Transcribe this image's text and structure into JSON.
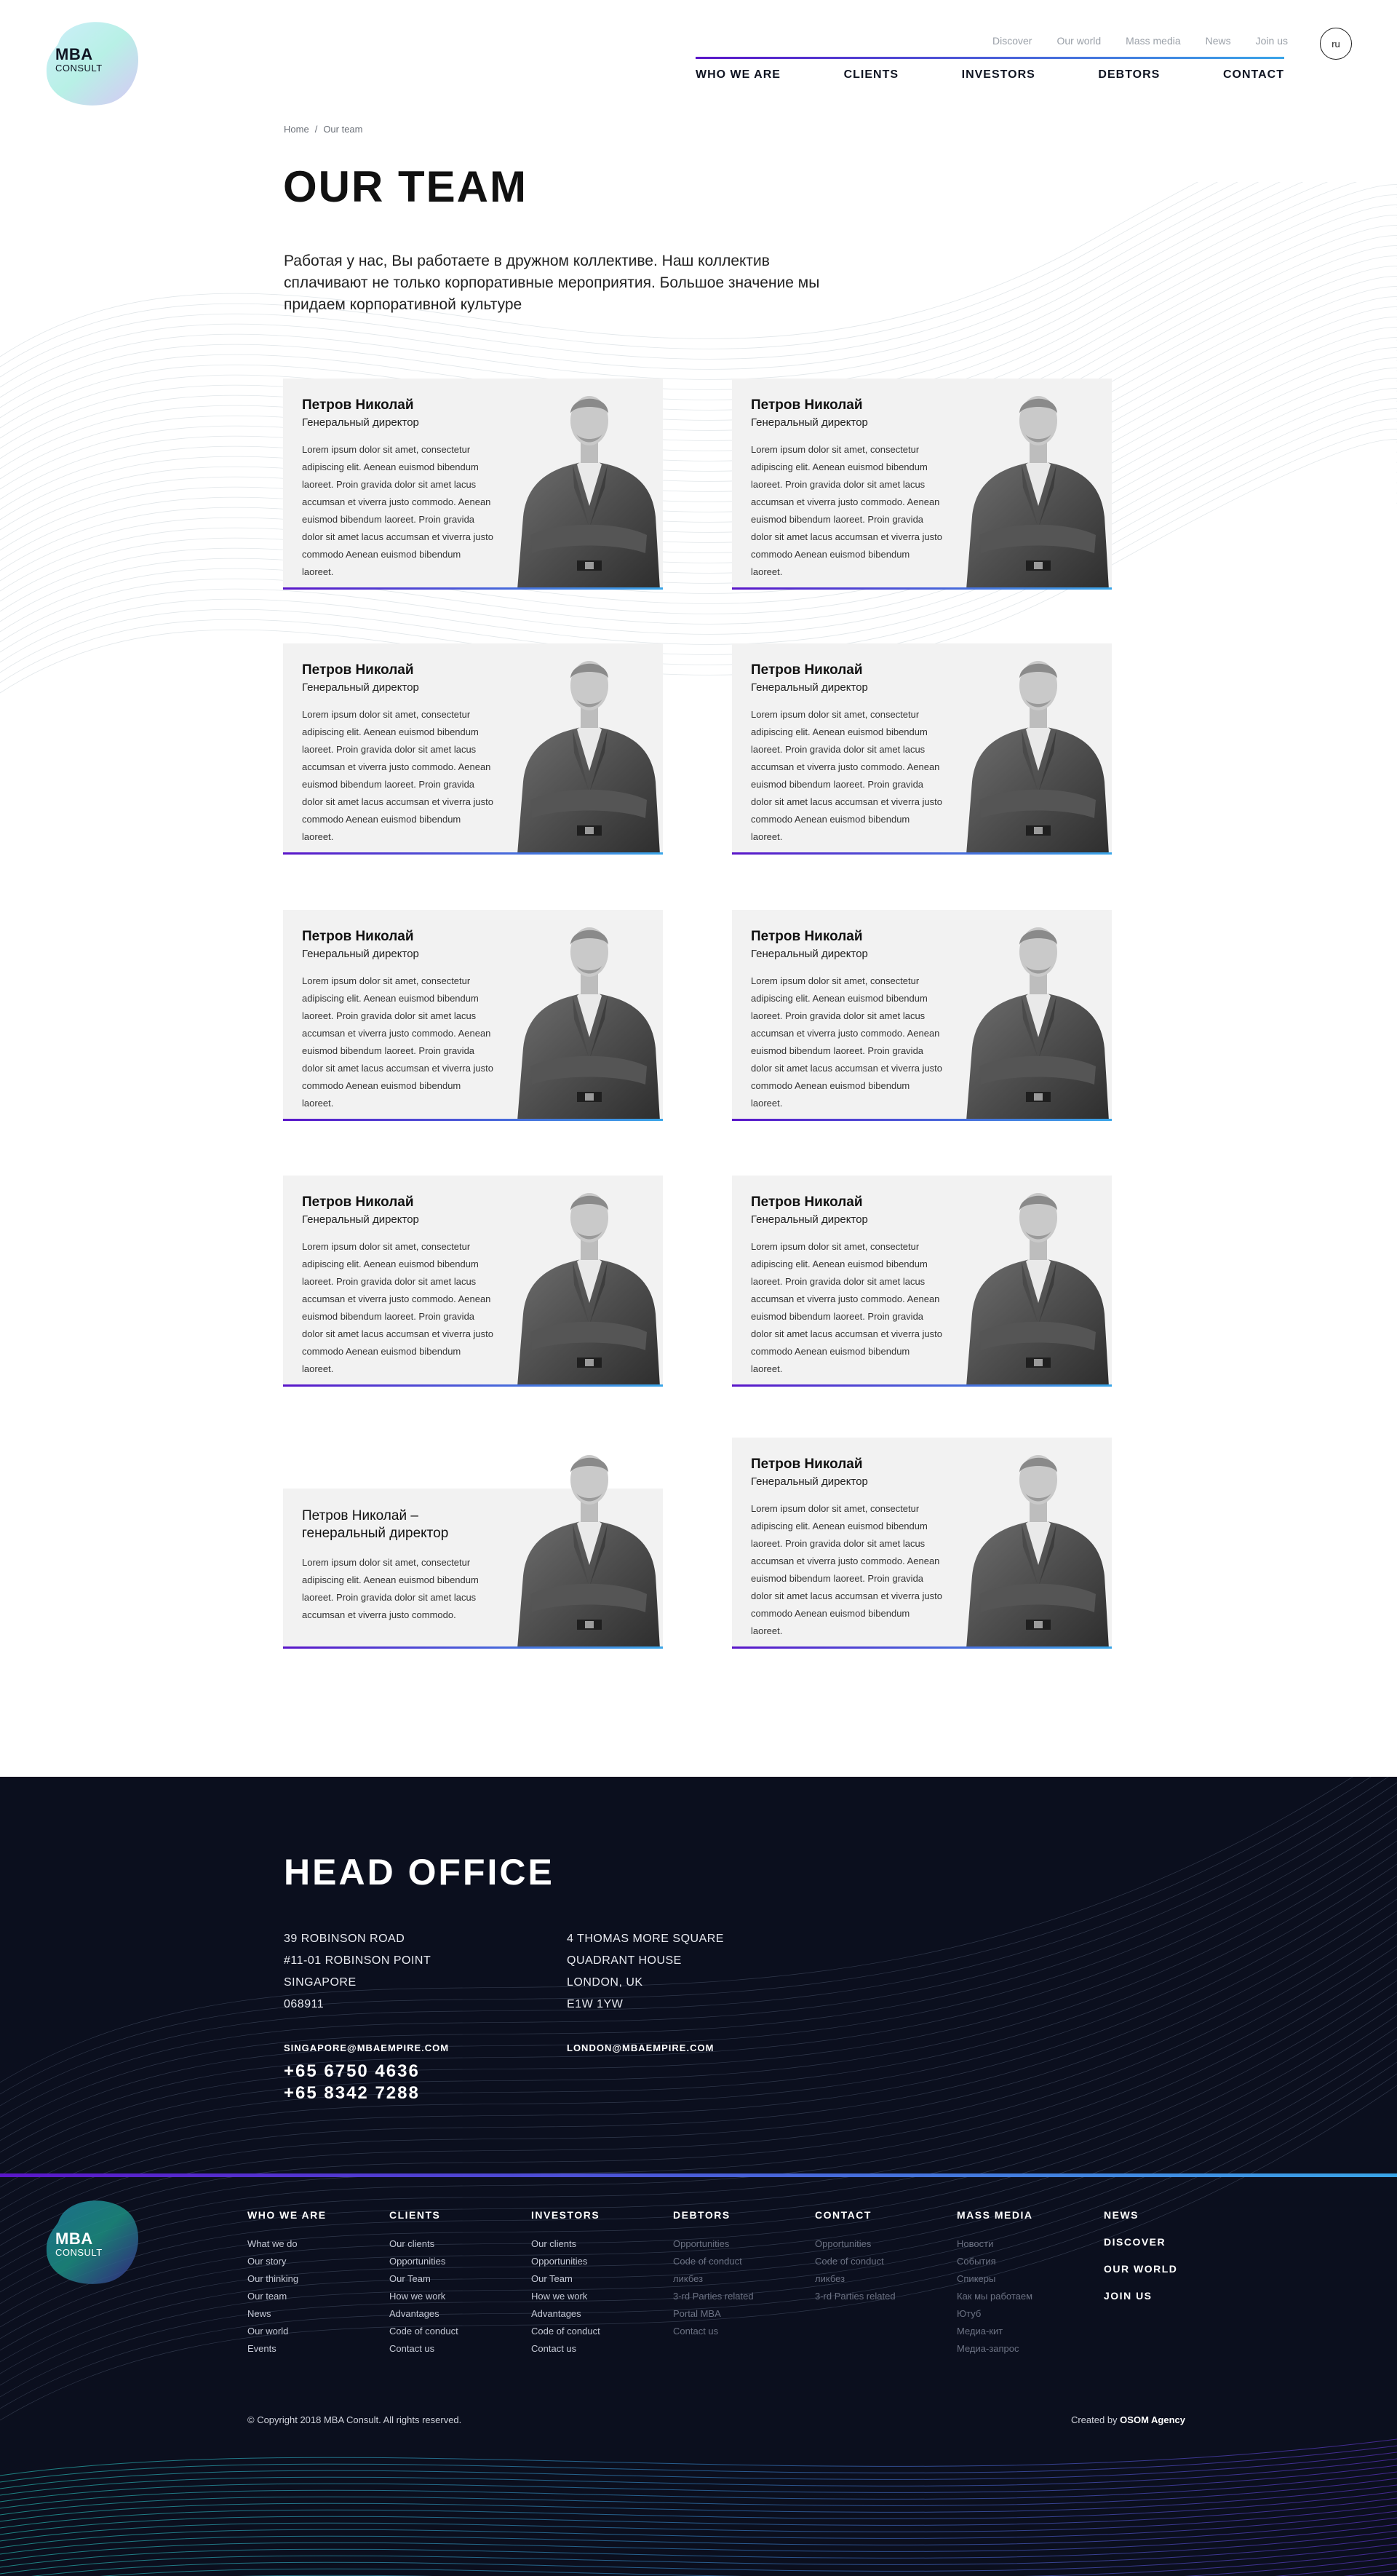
{
  "colors": {
    "accent_start": "#5a16c9",
    "accent_end": "#3aa5e8",
    "footer_bg": "#0b0f1e",
    "card_bg": "#f2f2f2"
  },
  "logo": {
    "line1": "MBA",
    "line2": "CONSULT"
  },
  "header": {
    "topnav": [
      "Discover",
      "Our world",
      "Mass media",
      "News",
      "Join us"
    ],
    "mainnav": [
      "WHO WE ARE",
      "CLIENTS",
      "INVESTORS",
      "DEBTORS",
      "CONTACT"
    ],
    "lang": "ru"
  },
  "breadcrumb": {
    "home": "Home",
    "sep": "/",
    "current": "Our team"
  },
  "page": {
    "title": "OUR TEAM",
    "intro": "Работая у нас, Вы работаете в дружном коллективе. Наш коллектив сплачивают не только корпоративные мероприятия. Большое значение мы придаем корпоративной культуре"
  },
  "team": [
    {
      "name": "Петров Николай",
      "role": "Генеральный директор",
      "desc": "Lorem ipsum dolor sit amet, consectetur adipiscing elit. Aenean euismod bibendum laoreet. Proin gravida dolor sit amet lacus accumsan et viverra justo commodo. Aenean euismod bibendum laoreet. Proin gravida dolor sit amet lacus accumsan et viverra justo commodo Aenean euismod bibendum laoreet."
    },
    {
      "name": "Петров Николай",
      "role": "Генеральный директор",
      "desc": "Lorem ipsum dolor sit amet, consectetur adipiscing elit. Aenean euismod bibendum laoreet. Proin gravida dolor sit amet lacus accumsan et viverra justo commodo. Aenean euismod bibendum laoreet. Proin gravida dolor sit amet lacus accumsan et viverra justo commodo Aenean euismod bibendum laoreet."
    },
    {
      "name": "Петров Николай",
      "role": "Генеральный директор",
      "desc": "Lorem ipsum dolor sit amet, consectetur adipiscing elit. Aenean euismod bibendum laoreet. Proin gravida dolor sit amet lacus accumsan et viverra justo commodo. Aenean euismod bibendum laoreet. Proin gravida dolor sit amet lacus accumsan et viverra justo commodo Aenean euismod bibendum laoreet."
    },
    {
      "name": "Петров Николай",
      "role": "Генеральный директор",
      "desc": "Lorem ipsum dolor sit amet, consectetur adipiscing elit. Aenean euismod bibendum laoreet. Proin gravida dolor sit amet lacus accumsan et viverra justo commodo. Aenean euismod bibendum laoreet. Proin gravida dolor sit amet lacus accumsan et viverra justo commodo Aenean euismod bibendum laoreet."
    },
    {
      "name": "Петров Николай",
      "role": "Генеральный директор",
      "desc": "Lorem ipsum dolor sit amet, consectetur adipiscing elit. Aenean euismod bibendum laoreet. Proin gravida dolor sit amet lacus accumsan et viverra justo commodo. Aenean euismod bibendum laoreet. Proin gravida dolor sit amet lacus accumsan et viverra justo commodo Aenean euismod bibendum laoreet."
    },
    {
      "name": "Петров Николай",
      "role": "Генеральный директор",
      "desc": "Lorem ipsum dolor sit amet, consectetur adipiscing elit. Aenean euismod bibendum laoreet. Proin gravida dolor sit amet lacus accumsan et viverra justo commodo. Aenean euismod bibendum laoreet. Proin gravida dolor sit amet lacus accumsan et viverra justo commodo Aenean euismod bibendum laoreet."
    },
    {
      "name": "Петров Николай",
      "role": "Генеральный директор",
      "desc": "Lorem ipsum dolor sit amet, consectetur adipiscing elit. Aenean euismod bibendum laoreet. Proin gravida dolor sit amet lacus accumsan et viverra justo commodo. Aenean euismod bibendum laoreet. Proin gravida dolor sit amet lacus accumsan et viverra justo commodo Aenean euismod bibendum laoreet."
    },
    {
      "name": "Петров Николай",
      "role": "Генеральный директор",
      "desc": "Lorem ipsum dolor sit amet, consectetur adipiscing elit. Aenean euismod bibendum laoreet. Proin gravida dolor sit amet lacus accumsan et viverra justo commodo. Aenean euismod bibendum laoreet. Proin gravida dolor sit amet lacus accumsan et viverra justo commodo Aenean euismod bibendum laoreet."
    },
    {
      "name": "Петров Николай –\nгенеральный директор",
      "role": "",
      "desc": "Lorem ipsum dolor sit amet, consectetur adipiscing elit. Aenean euismod bibendum laoreet. Proin gravida dolor sit amet lacus accumsan et viverra justo commodo."
    },
    {
      "name": "Петров Николай",
      "role": "Генеральный директор",
      "desc": "Lorem ipsum dolor sit amet, consectetur adipiscing elit. Aenean euismod bibendum laoreet. Proin gravida dolor sit amet lacus accumsan et viverra justo commodo. Aenean euismod bibendum laoreet. Proin gravida dolor sit amet lacus accumsan et viverra justo commodo Aenean euismod bibendum laoreet."
    }
  ],
  "footer": {
    "office_title": "HEAD OFFICE",
    "office1": {
      "l1": "39 ROBINSON ROAD",
      "l2": "#11-01 ROBINSON POINT",
      "l3": "SINGAPORE",
      "l4": "068911",
      "email": "SINGAPORE@MBAEMPIRE.COM",
      "phone1": "+65 6750 4636",
      "phone2": "+65 8342 7288"
    },
    "office2": {
      "l1": "4 THOMAS MORE SQUARE",
      "l2": "QUADRANT HOUSE",
      "l3": "LONDON, UK",
      "l4": "E1W 1YW",
      "email": "LONDON@MBAEMPIRE.COM"
    },
    "columns": [
      {
        "title": "WHO WE ARE",
        "items": [
          "What we do",
          "Our story",
          "Our thinking",
          "Our team",
          "News",
          "Our world",
          "Events"
        ]
      },
      {
        "title": "CLIENTS",
        "items": [
          "Our clients",
          "Opportunities",
          "Our Team",
          "How we work",
          "Advantages",
          "Code of conduct",
          "Contact us"
        ]
      },
      {
        "title": "INVESTORS",
        "items": [
          "Our clients",
          "Opportunities",
          "Our Team",
          "How we work",
          "Advantages",
          "Code of conduct",
          "Contact us"
        ]
      },
      {
        "title": "DEBTORS",
        "items": [
          "Opportunities",
          "Code of conduct",
          "ликбез",
          "3-rd Parties related",
          "Portal MBA",
          "Contact us"
        ]
      },
      {
        "title": "CONTACT",
        "items": [
          "Opportunities",
          "Code of conduct",
          "ликбез",
          "3-rd Parties related"
        ]
      },
      {
        "title": "MASS MEDIA",
        "items": [
          "Новости",
          "События",
          "Спикеры",
          "Как мы работаем",
          "Ютуб",
          "Медиа-кит",
          "Медиа-запрос"
        ]
      }
    ],
    "extra": [
      "NEWS",
      "DISCOVER",
      "OUR WORLD",
      "JOIN US"
    ],
    "copyright": "© Copyright 2018 MBA Consult. All rights reserved.",
    "created_by": "Created by",
    "agency": "OSOM Agency"
  }
}
